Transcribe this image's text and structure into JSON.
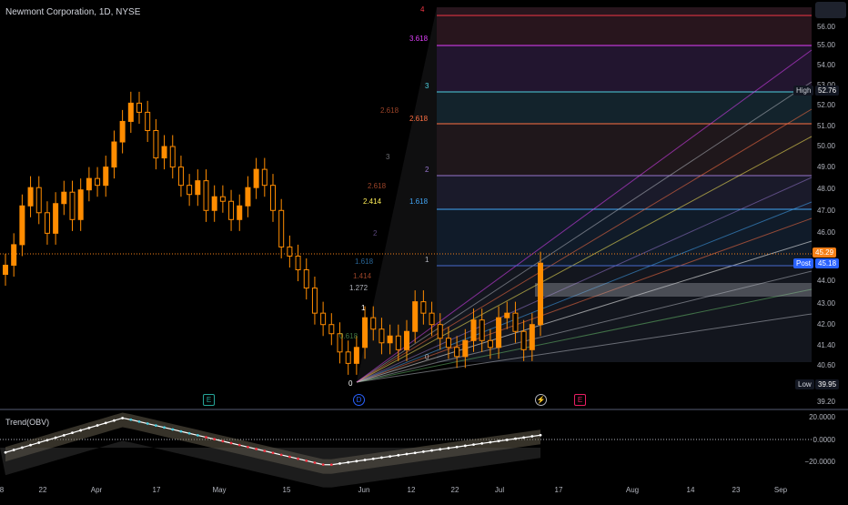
{
  "chart_title": "Newmont Corporation, 1D, NYSE",
  "price_axis": [
    "56.00",
    "55.00",
    "54.00",
    "53.00",
    "52.00",
    "51.00",
    "50.00",
    "49.00",
    "48.00",
    "47.00",
    "46.00",
    "45.00",
    "44.00",
    "43.00",
    "42.00",
    "41.40",
    "40.60",
    "39.20"
  ],
  "badges": {
    "high_label": "High",
    "high_value": "52.76",
    "last_value": "45.29",
    "post_label": "Post",
    "post_value": "45.18",
    "low_label": "Low",
    "low_value": "39.95"
  },
  "fib_right": [
    "4",
    "3.618",
    "3",
    "2.618",
    "2",
    "1.618",
    "1",
    "0"
  ],
  "fib_left": [
    "1.618",
    "2.618",
    "3",
    "2.618",
    "2.414",
    "2",
    "1.618",
    "1.414",
    "1.272",
    "1",
    "0.618",
    "0"
  ],
  "events": {
    "e1": "E",
    "d": "D",
    "bolt": "⚡",
    "e2": "E"
  },
  "indicator": {
    "name": "Trend(OBV)",
    "axis": [
      "20.0000",
      "0.0000",
      "−20.0000"
    ]
  },
  "x_axis": [
    "8",
    "22",
    "Apr",
    "17",
    "May",
    "15",
    "Jun",
    "12",
    "22",
    "Jul",
    "17",
    "Aug",
    "14",
    "23",
    "Sep"
  ],
  "colors": {
    "up": "#ff8c00",
    "down": "#ff8c00",
    "post": "#2962ff",
    "last": "#f57f17"
  },
  "chart_data": {
    "type": "candlestick",
    "title": "Newmont Corporation, 1D, NYSE",
    "ylim": [
      39.2,
      56.5
    ],
    "close": [
      45.2,
      46.1,
      47.8,
      48.6,
      47.5,
      46.6,
      47.9,
      48.4,
      47.2,
      48.5,
      49.0,
      48.7,
      49.5,
      50.6,
      51.5,
      52.3,
      51.9,
      51.1,
      49.9,
      50.4,
      49.5,
      48.7,
      48.3,
      48.9,
      47.6,
      48.2,
      48.0,
      47.2,
      47.8,
      48.6,
      49.4,
      48.7,
      47.6,
      46.0,
      45.6,
      45.0,
      44.2,
      43.1,
      42.6,
      42.2,
      41.4,
      40.9,
      41.6,
      42.9,
      42.4,
      41.8,
      42.1,
      41.5,
      42.3,
      43.6,
      43.1,
      42.6,
      42.0,
      41.6,
      41.2,
      41.9,
      42.8,
      41.9,
      41.6,
      42.9,
      43.1,
      42.3,
      41.5,
      42.6,
      45.29
    ]
  }
}
